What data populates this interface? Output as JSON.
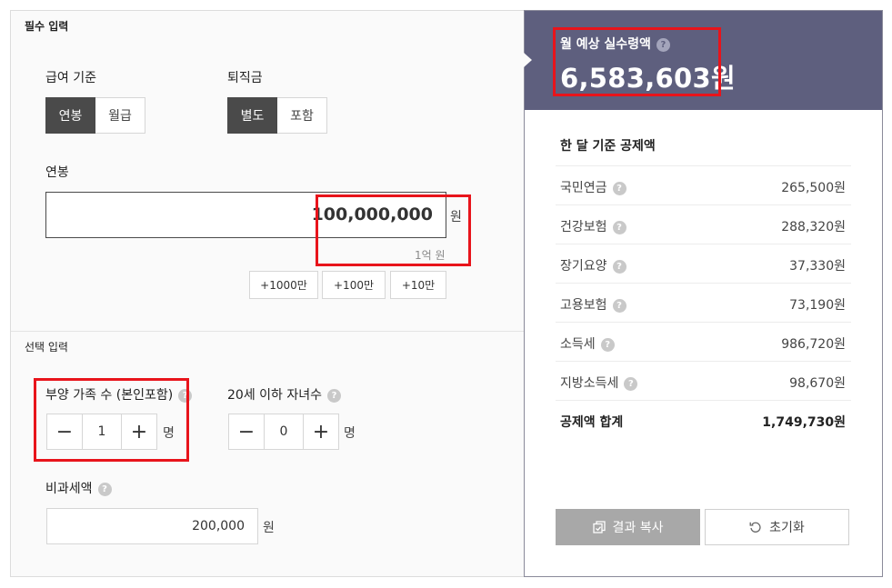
{
  "required": {
    "section_title": "필수 입력",
    "pay_basis": {
      "label": "급여 기준",
      "options": [
        "연봉",
        "월급"
      ],
      "selected": "연봉"
    },
    "severance": {
      "label": "퇴직금",
      "options": [
        "별도",
        "포함"
      ],
      "selected": "별도"
    },
    "salary": {
      "label": "연봉",
      "value": "100,000,000",
      "unit": "원",
      "hint": "1억 원"
    },
    "quick_add": [
      "+1000만",
      "+100만",
      "+10만"
    ]
  },
  "optional": {
    "section_title": "선택 입력",
    "dependents": {
      "label": "부양 가족 수 (본인포함)",
      "value": "1",
      "unit": "명",
      "minus": "−",
      "plus": "+"
    },
    "children": {
      "label": "20세 이하 자녀수",
      "value": "0",
      "unit": "명",
      "minus": "−",
      "plus": "+"
    },
    "nontax": {
      "label": "비과세액",
      "value": "200,000",
      "unit": "원"
    }
  },
  "result": {
    "label": "월 예상 실수령액",
    "value": "6,583,603원",
    "deductions_title": "한 달 기준 공제액",
    "deductions": [
      {
        "name": "국민연금",
        "value": "265,500원",
        "help": true
      },
      {
        "name": "건강보험",
        "value": "288,320원",
        "help": true
      },
      {
        "name": "장기요양",
        "value": "37,330원",
        "help": true
      },
      {
        "name": "고용보험",
        "value": "73,190원",
        "help": true
      },
      {
        "name": "소득세",
        "value": "986,720원",
        "help": true
      },
      {
        "name": "지방소득세",
        "value": "98,670원",
        "help": true
      }
    ],
    "total": {
      "name": "공제액 합계",
      "value": "1,749,730원"
    },
    "copy_button": "결과 복사",
    "reset_button": "초기화"
  },
  "help_glyph": "?",
  "colors": {
    "header_bg": "#5e5f7e",
    "active_seg": "#4a4a4a",
    "highlight": "#e8141b",
    "copy_btn": "#a8a8a8"
  }
}
